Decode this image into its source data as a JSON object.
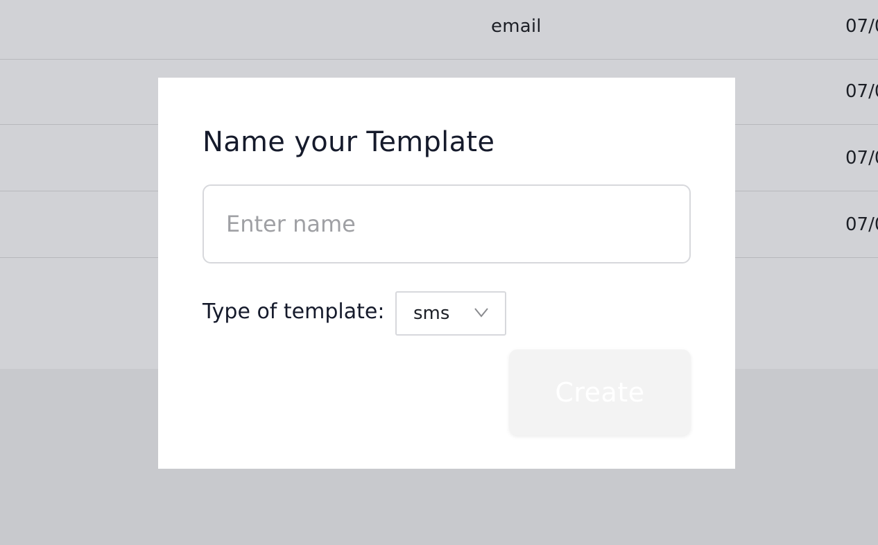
{
  "background_table": {
    "rows": [
      {
        "type": "email",
        "date": "07/0"
      },
      {
        "type": "",
        "date": "07/0"
      },
      {
        "type": "",
        "date": "07/0"
      },
      {
        "type": "",
        "date": "07/0"
      }
    ]
  },
  "modal": {
    "title": "Name your Template",
    "name_input": {
      "placeholder": "Enter name",
      "value": ""
    },
    "type_label": "Type of template:",
    "type_select": {
      "selected": "sms"
    },
    "create_button": "Create"
  },
  "colors": {
    "overlay": "#c8c9cd",
    "modal_bg": "#ffffff",
    "text": "#151a2b",
    "placeholder": "#9fa0a4",
    "button_disabled_bg": "#f3f3f3"
  }
}
